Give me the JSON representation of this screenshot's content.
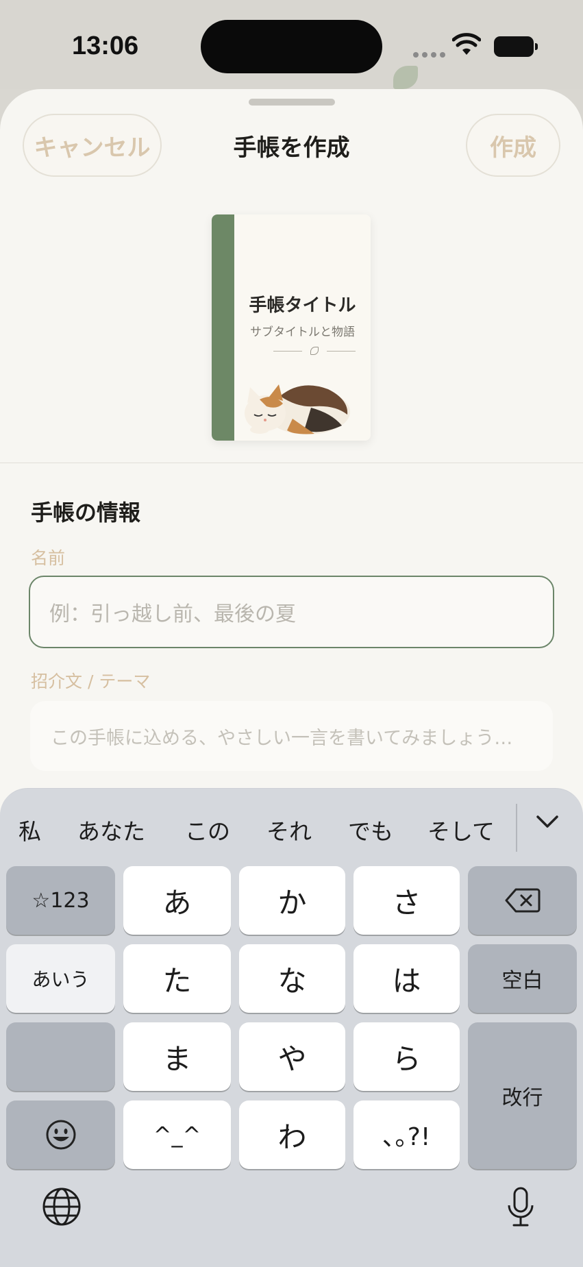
{
  "status_bar": {
    "time": "13:06"
  },
  "header": {
    "cancel_label": "キャンセル",
    "title": "手帳を作成",
    "create_label": "作成"
  },
  "cover_preview": {
    "title": "手帳タイトル",
    "subtitle": "サブタイトルと物語",
    "spine_color": "#6d8866"
  },
  "form": {
    "section_title": "手帳の情報",
    "name_label": "名前",
    "name_placeholder": "例：引っ越し前、最後の夏",
    "theme_label": "招介文 / テーマ",
    "theme_placeholder": "この手帳に込める、やさしい一言を書いてみましょう…"
  },
  "keyboard": {
    "candidates": [
      "私",
      "あなた",
      "この",
      "それ",
      "でも",
      "そして"
    ],
    "keys": {
      "numbers": "☆123",
      "a": "あ",
      "ka": "か",
      "sa": "さ",
      "kana_mode": "あいう",
      "ta": "た",
      "na": "な",
      "ha": "は",
      "space": "空白",
      "ma": "ま",
      "ya": "や",
      "ra": "ら",
      "return": "改行",
      "kaomoji": "^_^",
      "wa": "わ",
      "punct": "､｡?!"
    }
  },
  "colors": {
    "accent_green": "#6b8569",
    "muted_label": "#d6bfa0",
    "sheet_bg": "#f7f6f2"
  }
}
